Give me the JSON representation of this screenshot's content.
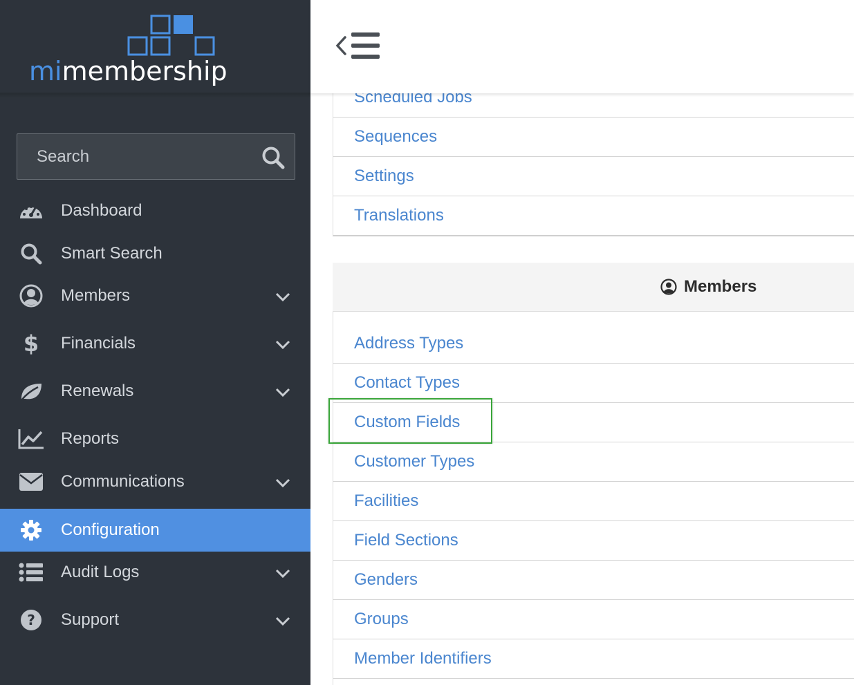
{
  "brand": {
    "logo_prefix": "mi",
    "logo_suffix": "membership",
    "accent": "#4a90e2"
  },
  "search": {
    "placeholder": "Search",
    "value": ""
  },
  "nav": {
    "dashboard": "Dashboard",
    "smart_search": "Smart Search",
    "members": "Members",
    "financials": "Financials",
    "renewals": "Renewals",
    "reports": "Reports",
    "communications": "Communications",
    "configuration": "Configuration",
    "audit_logs": "Audit Logs",
    "support": "Support"
  },
  "active_nav": "Configuration",
  "general_links": [
    "Scheduled Jobs",
    "Sequences",
    "Settings",
    "Translations"
  ],
  "members_panel": {
    "title": "Members",
    "links": [
      "Address Types",
      "Contact Types",
      "Custom Fields",
      "Customer Types",
      "Facilities",
      "Field Sections",
      "Genders",
      "Groups",
      "Member Identifiers"
    ]
  },
  "highlighted_link": "Custom Fields",
  "colors": {
    "sidebar_bg": "#2d333b",
    "active_bg": "#5090e1",
    "link": "#4a86cf",
    "highlight": "#3aa63a"
  }
}
